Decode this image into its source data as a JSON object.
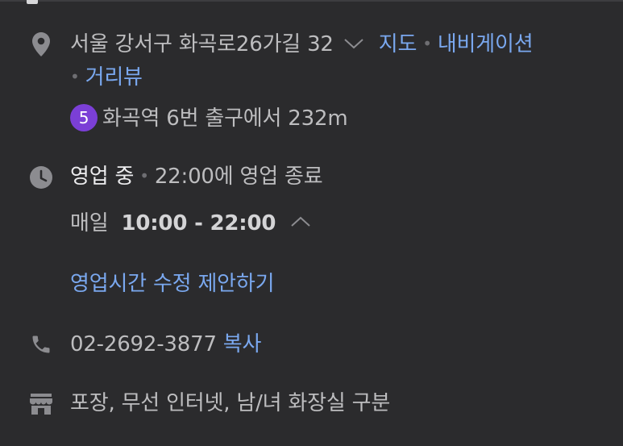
{
  "address": {
    "text": "서울 강서구 화곡로26가길 32",
    "map_link": "지도",
    "navigation_link": "내비게이션",
    "street_view_link": "거리뷰"
  },
  "transit": {
    "line_number": "5",
    "line_color": "#7b3fd6",
    "text": "화곡역 6번 출구에서 232m"
  },
  "hours": {
    "status": "영업 중",
    "closing": "22:00에 영업 종료",
    "day_label": "매일",
    "time_range": "10:00 - 22:00",
    "suggest_link": "영업시간 수정 제안하기"
  },
  "phone": {
    "number": "02-2692-3877",
    "copy_link": "복사"
  },
  "amenities": {
    "text": "포장, 무선 인터넷, 남/녀 화장실 구분"
  },
  "icons": {
    "address": "location-pin-icon",
    "hours": "clock-icon",
    "phone": "phone-icon",
    "amenities": "store-icon"
  },
  "colors": {
    "background": "#2b2b2d",
    "text": "#bdbdbf",
    "link": "#7aa8ef",
    "icon": "#8c8c90"
  }
}
